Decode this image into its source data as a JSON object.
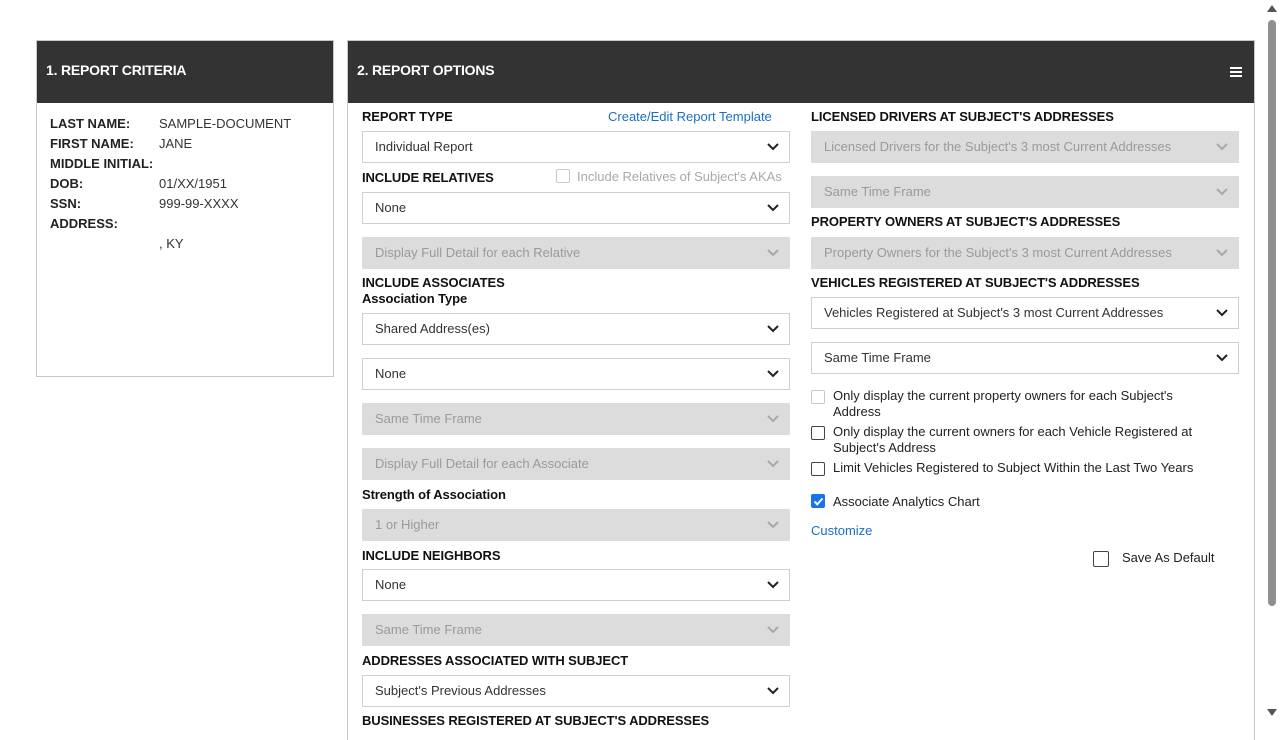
{
  "criteria": {
    "title": "1. REPORT CRITERIA",
    "rows": [
      {
        "label": "LAST NAME:",
        "value": "SAMPLE-DOCUMENT"
      },
      {
        "label": "FIRST NAME:",
        "value": "JANE"
      },
      {
        "label": "MIDDLE INITIAL:",
        "value": ""
      },
      {
        "label": "DOB:",
        "value": "01/XX/1951"
      },
      {
        "label": "SSN:",
        "value": "999-99-XXXX"
      },
      {
        "label": "ADDRESS:",
        "value": ""
      },
      {
        "label": "",
        "value": ", KY"
      }
    ]
  },
  "options": {
    "title": "2. REPORT OPTIONS",
    "menu_icon": "hamburger-icon",
    "report_type": {
      "label": "REPORT TYPE",
      "link": "Create/Edit Report Template",
      "value": "Individual Report"
    },
    "relatives": {
      "label": "INCLUDE RELATIVES",
      "aka_checkbox": "Include Relatives of Subject's AKAs",
      "value": "None",
      "detail": "Display Full Detail for each Relative"
    },
    "associates": {
      "label": "INCLUDE ASSOCIATES",
      "type_label": "Association Type",
      "type_value": "Shared Address(es)",
      "value": "None",
      "time_frame": "Same Time Frame",
      "detail": "Display Full Detail for each Associate",
      "strength_label": "Strength of Association",
      "strength_value": "1 or Higher"
    },
    "neighbors": {
      "label": "INCLUDE NEIGHBORS",
      "value": "None",
      "time_frame": "Same Time Frame"
    },
    "addresses": {
      "label": "ADDRESSES ASSOCIATED WITH SUBJECT",
      "value": "Subject's Previous Addresses"
    },
    "businesses": {
      "label": "BUSINESSES REGISTERED AT SUBJECT'S ADDRESSES"
    },
    "drivers": {
      "label": "LICENSED DRIVERS AT SUBJECT'S ADDRESSES",
      "value": "Licensed Drivers for the Subject's 3 most Current Addresses",
      "time_frame": "Same Time Frame"
    },
    "property": {
      "label": "PROPERTY OWNERS AT SUBJECT'S ADDRESSES",
      "value": "Property Owners for the Subject's 3 most Current Addresses"
    },
    "vehicles": {
      "label": "VEHICLES REGISTERED AT SUBJECT'S ADDRESSES",
      "value": "Vehicles Registered at Subject's 3 most Current Addresses",
      "time_frame": "Same Time Frame"
    },
    "checks": {
      "property_current": "Only display the current property owners for each Subject's Address",
      "vehicle_current": "Only display the current owners for each Vehicle Registered at Subject's Address",
      "limit_vehicles": "Limit Vehicles Registered to Subject Within the Last Two Years",
      "analytics": "Associate Analytics Chart"
    },
    "customize": "Customize",
    "save_default": "Save As Default"
  },
  "colors": {
    "header": "#333333",
    "link": "#1a6fc4",
    "checkbox_on": "#1a73e8",
    "disabled_bg": "#dcdcdc"
  }
}
